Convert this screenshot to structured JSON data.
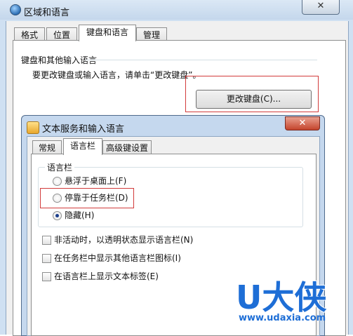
{
  "back_window": {
    "title": "区域和语言",
    "close_glyph": "✕",
    "tabs": [
      {
        "label": "格式"
      },
      {
        "label": "位置"
      },
      {
        "label": "键盘和语言"
      },
      {
        "label": "管理"
      }
    ],
    "keyboard_group": {
      "label": "键盘和其他输入语言",
      "description": "要更改键盘或输入语言，请单击“更改键盘”。",
      "button_label": "更改键盘(C)..."
    }
  },
  "front_dialog": {
    "title": "文本服务和输入语言",
    "close_glyph": "✕",
    "tabs": [
      {
        "label": "常规"
      },
      {
        "label": "语言栏"
      },
      {
        "label": "高级键设置"
      }
    ],
    "language_bar_group": {
      "label": "语言栏",
      "options": [
        {
          "label": "悬浮于桌面上(F)",
          "selected": false
        },
        {
          "label": "停靠于任务栏(D)",
          "selected": false
        },
        {
          "label": "隐藏(H)",
          "selected": true
        }
      ]
    },
    "checkboxes": [
      {
        "label": "非活动时，以透明状态显示语言栏(N)",
        "checked": false
      },
      {
        "label": "在任务栏中显示其他语言栏图标(I)",
        "checked": false
      },
      {
        "label": "在语言栏上显示文本标签(E)",
        "checked": false
      }
    ]
  },
  "watermark": {
    "logo_text": "U大侠",
    "url": "www.udaxia.com",
    "color": "#1e6ed6"
  },
  "colors": {
    "highlight_box": "#d23b3b",
    "close_button": "#c4442c"
  }
}
